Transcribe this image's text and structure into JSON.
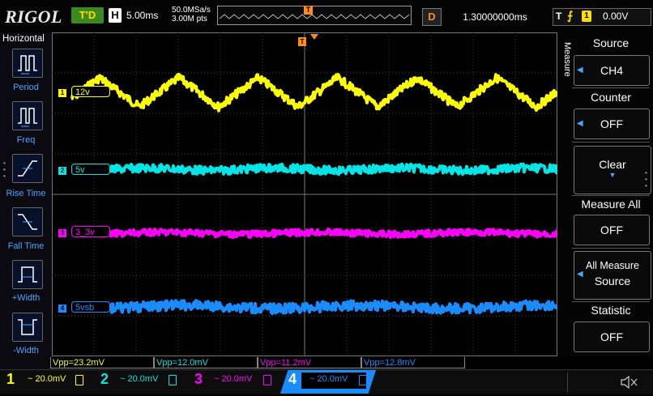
{
  "header": {
    "brand": "RIGOL",
    "run_state": "T'D",
    "timebase_key": "H",
    "timebase": "5.00ms",
    "sample_rate": "50.0MSa/s",
    "memory_depth": "3.00M pts",
    "trigger_pos_marker": "T",
    "delay_key": "D",
    "delay": "1.30000000ms",
    "trigger_key": "T",
    "trigger_source": "1",
    "trigger_level": "0.00V"
  },
  "left_panel": {
    "title": "Horizontal",
    "items": [
      {
        "label": "Period",
        "icon": "period-icon"
      },
      {
        "label": "Freq",
        "icon": "freq-icon"
      },
      {
        "label": "Rise Time",
        "icon": "rise-time-icon"
      },
      {
        "label": "Fall Time",
        "icon": "fall-time-icon"
      },
      {
        "label": "+Width",
        "icon": "pos-width-icon"
      },
      {
        "label": "-Width",
        "icon": "neg-width-icon"
      }
    ]
  },
  "right_panel": {
    "menu_title": "Measure",
    "source_label": "Source",
    "source_value": "CH4",
    "counter_label": "Counter",
    "counter_value": "OFF",
    "clear_label": "Clear",
    "measure_all_label": "Measure All",
    "measure_all_value": "OFF",
    "all_measure_source_line1": "All Measure",
    "all_measure_source_line2": "Source",
    "statistic_label": "Statistic",
    "statistic_value": "OFF"
  },
  "waveforms": [
    {
      "channel": "1",
      "label": "12v",
      "color": "#ffff00"
    },
    {
      "channel": "2",
      "label": "5v",
      "color": "#00e5e5"
    },
    {
      "channel": "3",
      "label": "3_3v",
      "color": "#ff00ff"
    },
    {
      "channel": "4",
      "label": "5vsb",
      "color": "#1a8cff"
    }
  ],
  "measurements": [
    {
      "text": "Vpp=23.2mV",
      "color": "#ffff00"
    },
    {
      "text": "Vpp=12.0mV",
      "color": "#00e5e5"
    },
    {
      "text": "Vpp=11.2mV",
      "color": "#ff00ff"
    },
    {
      "text": "Vpp=12.8mV",
      "color": "#1a8cff"
    }
  ],
  "channels": [
    {
      "number": "1",
      "scale": "~ 20.0mV",
      "color": "#ffff00"
    },
    {
      "number": "2",
      "scale": "~ 20.0mV",
      "color": "#00e5e5"
    },
    {
      "number": "3",
      "scale": "~ 20.0mV",
      "color": "#ff00ff"
    },
    {
      "number": "4",
      "scale": "~ 20.0mV",
      "color": "#1a8cff"
    }
  ],
  "icons": {
    "sound": "speaker-muted-icon"
  }
}
